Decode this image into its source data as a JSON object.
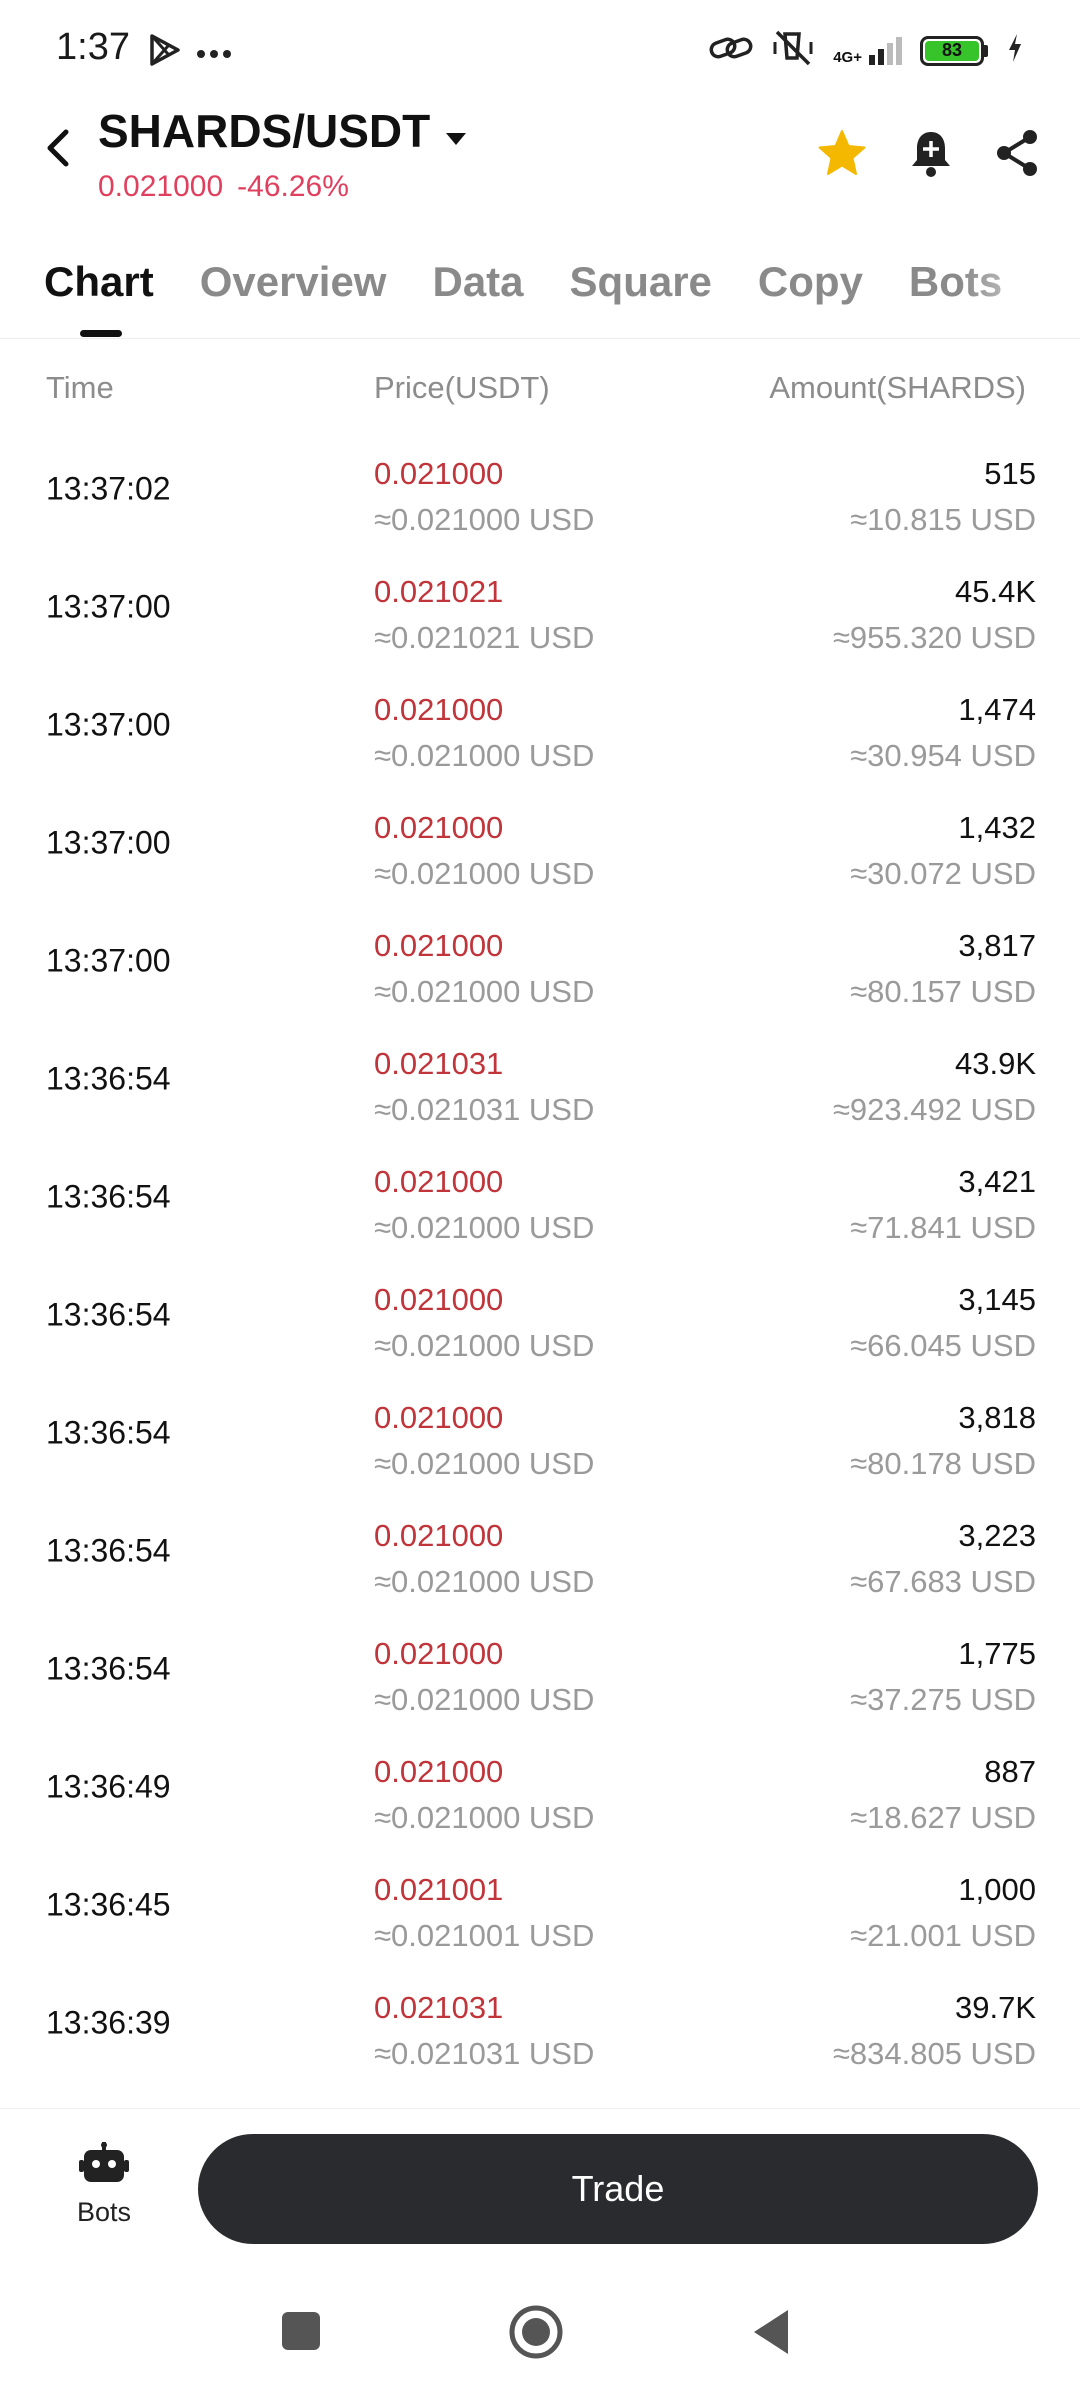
{
  "status_bar": {
    "time": "1:37",
    "battery_level": "83",
    "network": "4G+"
  },
  "header": {
    "pair": "SHARDS/USDT",
    "last_price": "0.021000",
    "change_percent": "-46.26%"
  },
  "tabs": [
    {
      "label": "Chart",
      "active": true
    },
    {
      "label": "Overview",
      "active": false
    },
    {
      "label": "Data",
      "active": false
    },
    {
      "label": "Square",
      "active": false
    },
    {
      "label": "Copy",
      "active": false
    },
    {
      "label": "Bots",
      "active": false
    }
  ],
  "table": {
    "headers": {
      "time": "Time",
      "price": "Price(USDT)",
      "amount": "Amount(SHARDS)"
    },
    "rows": [
      {
        "time": "13:37:02",
        "price": "0.021000",
        "price_usd": "≈0.021000 USD",
        "amount": "515",
        "amount_usd": "≈10.815 USD"
      },
      {
        "time": "13:37:00",
        "price": "0.021021",
        "price_usd": "≈0.021021 USD",
        "amount": "45.4K",
        "amount_usd": "≈955.320 USD"
      },
      {
        "time": "13:37:00",
        "price": "0.021000",
        "price_usd": "≈0.021000 USD",
        "amount": "1,474",
        "amount_usd": "≈30.954 USD"
      },
      {
        "time": "13:37:00",
        "price": "0.021000",
        "price_usd": "≈0.021000 USD",
        "amount": "1,432",
        "amount_usd": "≈30.072 USD"
      },
      {
        "time": "13:37:00",
        "price": "0.021000",
        "price_usd": "≈0.021000 USD",
        "amount": "3,817",
        "amount_usd": "≈80.157 USD"
      },
      {
        "time": "13:36:54",
        "price": "0.021031",
        "price_usd": "≈0.021031 USD",
        "amount": "43.9K",
        "amount_usd": "≈923.492 USD"
      },
      {
        "time": "13:36:54",
        "price": "0.021000",
        "price_usd": "≈0.021000 USD",
        "amount": "3,421",
        "amount_usd": "≈71.841 USD"
      },
      {
        "time": "13:36:54",
        "price": "0.021000",
        "price_usd": "≈0.021000 USD",
        "amount": "3,145",
        "amount_usd": "≈66.045 USD"
      },
      {
        "time": "13:36:54",
        "price": "0.021000",
        "price_usd": "≈0.021000 USD",
        "amount": "3,818",
        "amount_usd": "≈80.178 USD"
      },
      {
        "time": "13:36:54",
        "price": "0.021000",
        "price_usd": "≈0.021000 USD",
        "amount": "3,223",
        "amount_usd": "≈67.683 USD"
      },
      {
        "time": "13:36:54",
        "price": "0.021000",
        "price_usd": "≈0.021000 USD",
        "amount": "1,775",
        "amount_usd": "≈37.275 USD"
      },
      {
        "time": "13:36:49",
        "price": "0.021000",
        "price_usd": "≈0.021000 USD",
        "amount": "887",
        "amount_usd": "≈18.627 USD"
      },
      {
        "time": "13:36:45",
        "price": "0.021001",
        "price_usd": "≈0.021001 USD",
        "amount": "1,000",
        "amount_usd": "≈21.001 USD"
      },
      {
        "time": "13:36:39",
        "price": "0.021031",
        "price_usd": "≈0.021031 USD",
        "amount": "39.7K",
        "amount_usd": "≈834.805 USD"
      }
    ]
  },
  "bottom_bar": {
    "bots_label": "Bots",
    "trade_label": "Trade"
  },
  "colors": {
    "price_red": "#c0343a",
    "change_red": "#e0405e",
    "star_gold": "#f5b800",
    "trade_button": "#2a2b2e"
  },
  "icons": [
    "play-store-icon",
    "more-dots-icon",
    "link-icon",
    "mute-icon",
    "signal-icon",
    "battery-icon",
    "charging-icon",
    "back-arrow-icon",
    "dropdown-caret-icon",
    "star-icon",
    "bell-plus-icon",
    "share-icon",
    "robot-icon",
    "nav-square-icon",
    "nav-home-icon",
    "nav-back-icon"
  ]
}
